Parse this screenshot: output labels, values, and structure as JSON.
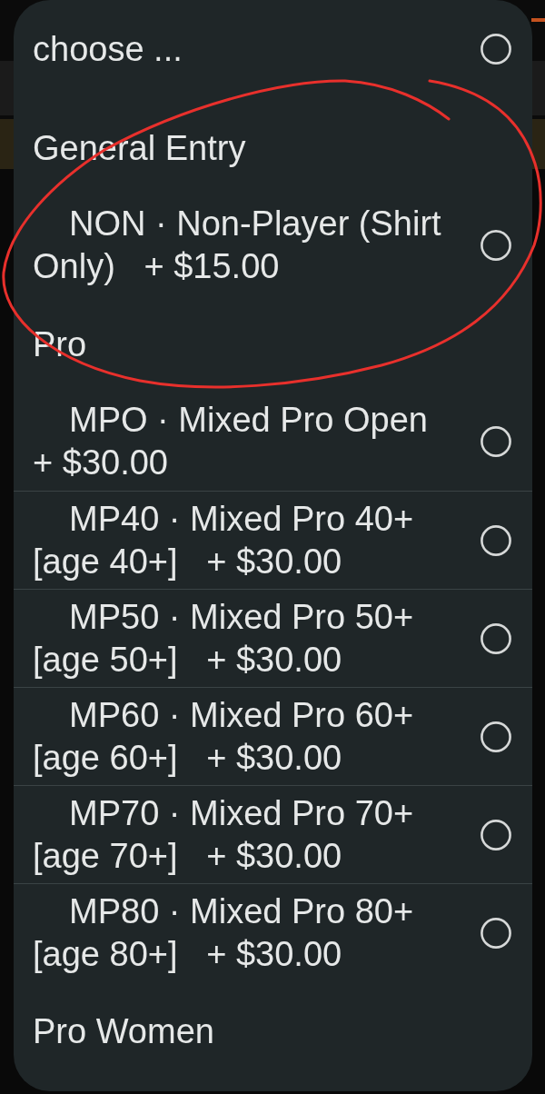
{
  "dialog": {
    "items": [
      {
        "kind": "option",
        "label": "choose ...",
        "selected": false
      },
      {
        "kind": "group",
        "label": "General Entry",
        "children": [
          {
            "kind": "option",
            "label": "NON · Non-Player (Shirt Only)   + $15.00",
            "selected": false
          }
        ]
      },
      {
        "kind": "group",
        "label": "Pro",
        "children": [
          {
            "kind": "option",
            "label": "MPO · Mixed Pro Open   + $30.00",
            "selected": false
          },
          {
            "kind": "option",
            "label": "MP40 · Mixed Pro 40+ [age 40+]   + $30.00",
            "selected": false
          },
          {
            "kind": "option",
            "label": "MP50 · Mixed Pro 50+ [age 50+]   + $30.00",
            "selected": false
          },
          {
            "kind": "option",
            "label": "MP60 · Mixed Pro 60+ [age 60+]   + $30.00",
            "selected": false
          },
          {
            "kind": "option",
            "label": "MP70 · Mixed Pro 70+ [age 70+]   + $30.00",
            "selected": false
          },
          {
            "kind": "option",
            "label": "MP80 · Mixed Pro 80+ [age 80+]   + $30.00",
            "selected": false
          }
        ]
      },
      {
        "kind": "group",
        "label": "Pro Women"
      }
    ]
  }
}
